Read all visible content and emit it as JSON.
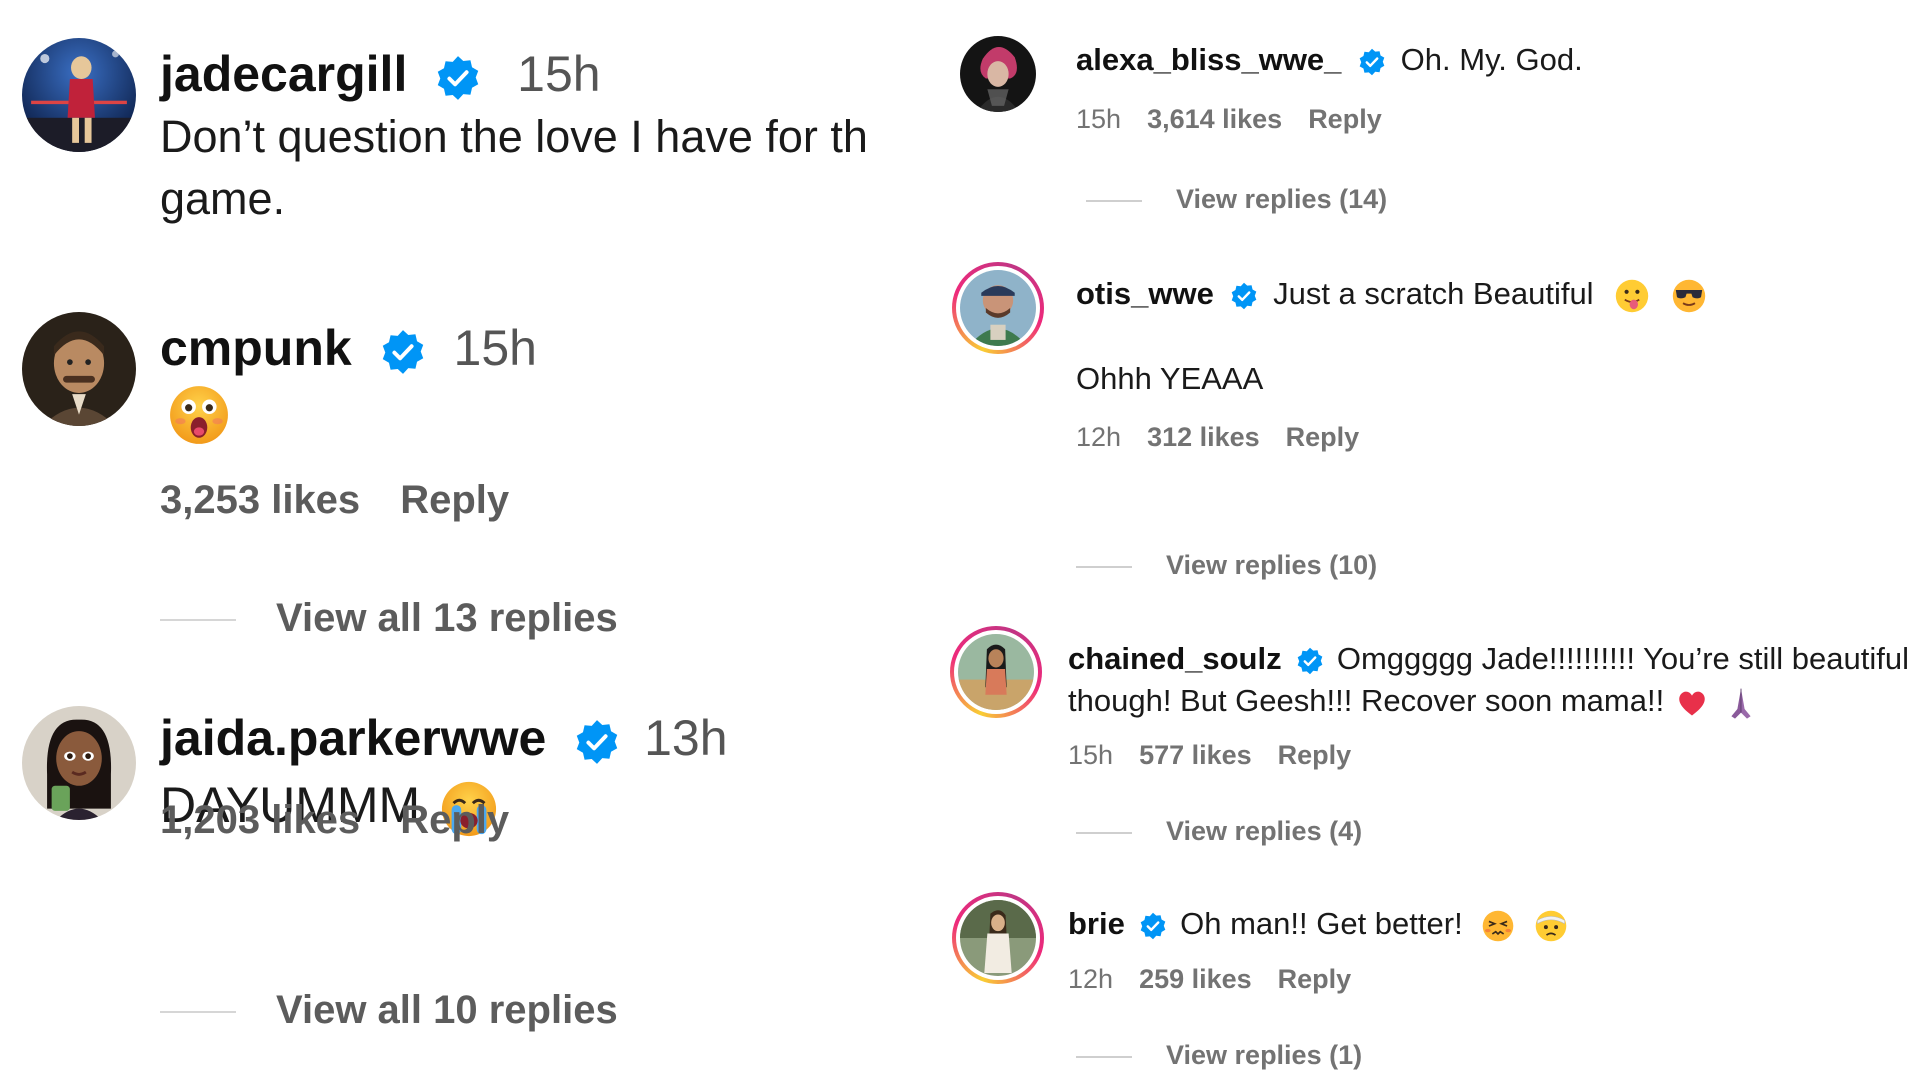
{
  "left_comments": [
    {
      "username": "jadecargill",
      "verified": true,
      "time": "15h",
      "text": "Don’t question the love I have for th",
      "text_line2": "game."
    },
    {
      "username": "cmpunk",
      "verified": true,
      "time": "15h",
      "emoji": "astonished-face-emoji",
      "likes": "3,253 likes",
      "reply": "Reply",
      "view_replies": "View all 13 replies"
    },
    {
      "username": "jaida.parkerwwe",
      "verified": true,
      "time": "13h",
      "text": "DAYUMMM",
      "emoji": "crying-face-emoji",
      "likes": "1,203 likes",
      "reply": "Reply",
      "view_replies": "View all 10 replies"
    }
  ],
  "right_comments": [
    {
      "username": "alexa_bliss_wwe_",
      "verified": true,
      "text": "Oh. My. God.",
      "time": "15h",
      "likes": "3,614 likes",
      "reply": "Reply",
      "view_replies": "View replies (14)"
    },
    {
      "username": "otis_wwe",
      "verified": true,
      "text": "Just a scratch Beautiful",
      "emojis": [
        "tongue-face-emoji",
        "sunglasses-face-emoji"
      ],
      "text_line2": "Ohhh YEAAA",
      "time": "12h",
      "likes": "312 likes",
      "reply": "Reply",
      "view_replies": "View replies (10)"
    },
    {
      "username": "chained_soulz",
      "verified": true,
      "text": "Omggggg Jade!!!!!!!!!! You’re still beautiful",
      "text_line2": "though! But Geesh!!! Recover soon mama!!",
      "emojis": [
        "red-heart-emoji",
        "praying-hands-emoji"
      ],
      "time": "15h",
      "likes": "577 likes",
      "reply": "Reply",
      "view_replies": "View replies (4)"
    },
    {
      "username": "brie",
      "verified": true,
      "text": "Oh man!! Get better!",
      "emojis": [
        "persevering-face-emoji",
        "bandaged-face-emoji"
      ],
      "time": "12h",
      "likes": "259 likes",
      "reply": "Reply",
      "view_replies": "View replies (1)"
    }
  ],
  "colors": {
    "verified_blue": "#0095f6",
    "meta_gray": "#737373",
    "story_ring": [
      "#f9ce34",
      "#ee2a7b",
      "#c13584"
    ]
  }
}
